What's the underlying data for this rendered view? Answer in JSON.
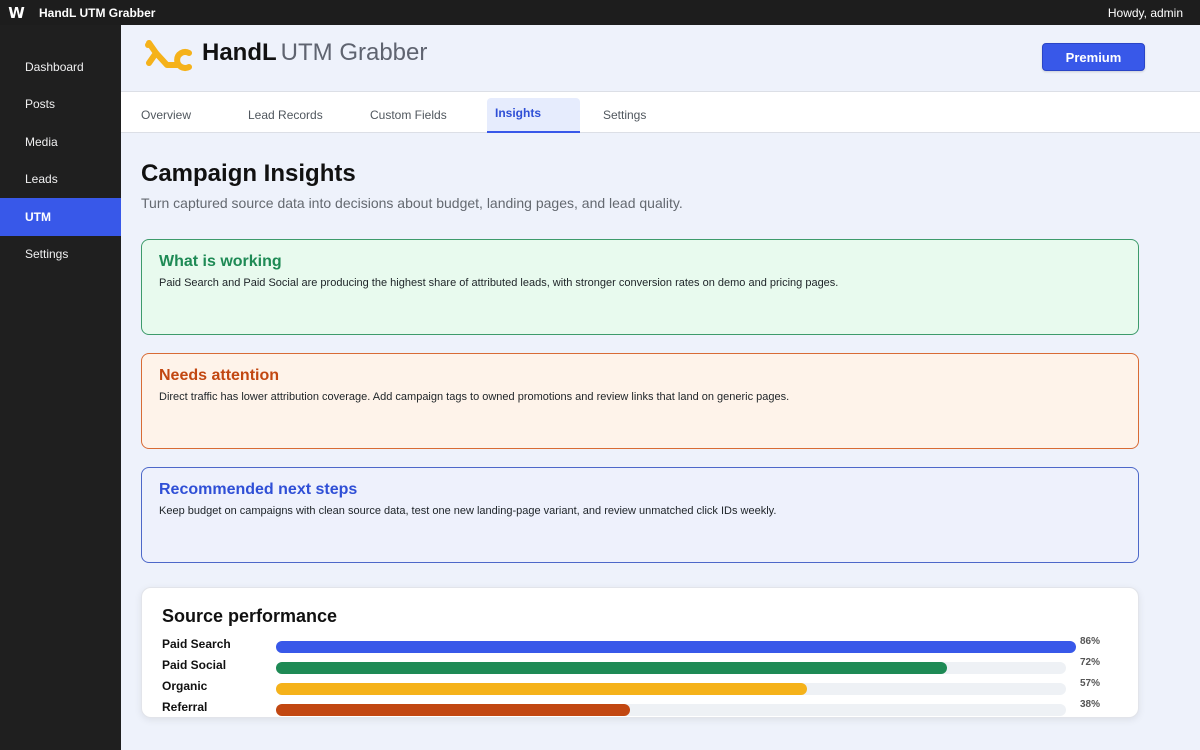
{
  "adminbar": {
    "wp_logo": "W",
    "site_name": "HandL UTM Grabber",
    "howdy": "Howdy, admin"
  },
  "sidebar": {
    "items": [
      {
        "label": "Dashboard",
        "active": false
      },
      {
        "label": "Posts",
        "active": false
      },
      {
        "label": "Media",
        "active": false
      },
      {
        "label": "Leads",
        "active": false
      },
      {
        "label": "UTM",
        "active": true
      },
      {
        "label": "Settings",
        "active": false
      }
    ]
  },
  "header": {
    "brand_strong": "HandL",
    "brand_light": "UTM Grabber",
    "premium_label": "Premium",
    "logo_icon": "handl-logo-icon",
    "accent": "#3858e9",
    "logo_color": "#f5b21a"
  },
  "tabs": [
    {
      "label": "Overview",
      "active": false
    },
    {
      "label": "Lead Records",
      "active": false
    },
    {
      "label": "Custom Fields",
      "active": false
    },
    {
      "label": "Insights",
      "active": true
    },
    {
      "label": "Settings",
      "active": false
    }
  ],
  "page": {
    "title": "Campaign Insights",
    "subtitle": "Turn captured source data into decisions about budget, landing pages, and lead quality."
  },
  "cards": [
    {
      "kind": "good",
      "title": "What is working",
      "body": "Paid Search and Paid Social are producing the highest share of attributed leads, with stronger conversion rates on demo and pricing pages."
    },
    {
      "kind": "warn",
      "title": "Needs attention",
      "body": "Direct traffic has lower attribution coverage. Add campaign tags to owned promotions and review links that land on generic pages."
    },
    {
      "kind": "next",
      "title": "Recommended next steps",
      "body": "Keep budget on campaigns with clean source data, test one new landing-page variant, and review unmatched click IDs weekly."
    }
  ],
  "performance": {
    "title": "Source performance",
    "rows": [
      {
        "label": "Paid Search",
        "percent": 86,
        "display": "86%",
        "color": "#3858e9"
      },
      {
        "label": "Paid Social",
        "percent": 72,
        "display": "72%",
        "color": "#1e8a55"
      },
      {
        "label": "Organic",
        "percent": 57,
        "display": "57%",
        "color": "#f5b21a"
      },
      {
        "label": "Referral",
        "percent": 38,
        "display": "38%",
        "color": "#c24711"
      }
    ]
  }
}
